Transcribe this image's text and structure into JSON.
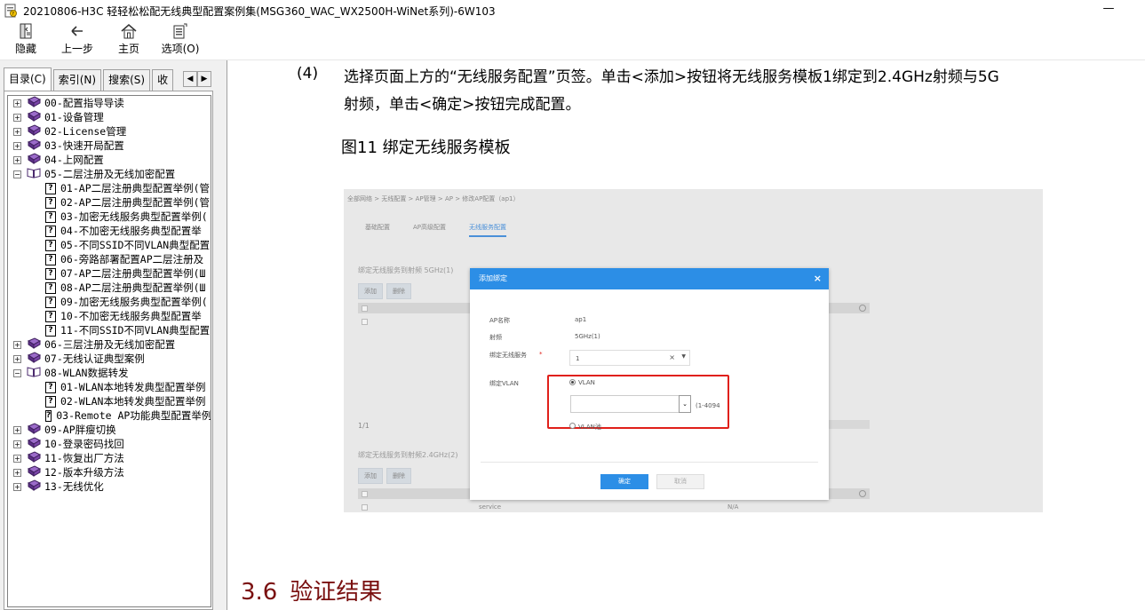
{
  "window": {
    "title": "20210806-H3C 轻轻松松配无线典型配置案例集(MSG360_WAC_WX2500H-WiNet系列)-6W103",
    "minimize_glyph": "—"
  },
  "toolbar": {
    "hide_label": "隐藏",
    "back_label": "上一步",
    "home_label": "主页",
    "options_label": "选项(O)"
  },
  "tabs": {
    "contents": "目录(C)",
    "index": "索引(N)",
    "search": "搜索(S)",
    "favorites": "收",
    "prev": "◀",
    "next": "▶"
  },
  "tree": {
    "items": [
      {
        "label": "00-配置指导导读",
        "exp": "+"
      },
      {
        "label": "01-设备管理",
        "exp": "+"
      },
      {
        "label": "02-License管理",
        "exp": "+"
      },
      {
        "label": "03-快速开局配置",
        "exp": "+"
      },
      {
        "label": "04-上网配置",
        "exp": "+"
      },
      {
        "label": "05-二层注册及无线加密配置",
        "exp": "−"
      }
    ],
    "children05": [
      "01-AP二层注册典型配置举例(管",
      "02-AP二层注册典型配置举例(管",
      "03-加密无线服务典型配置举例(",
      "04-不加密无线服务典型配置举",
      "05-不同SSID不同VLAN典型配置",
      "06-旁路部署配置AP二层注册及",
      "07-AP二层注册典型配置举例(Ш",
      "08-AP二层注册典型配置举例(Ш",
      "09-加密无线服务典型配置举例(",
      "10-不加密无线服务典型配置举",
      "11-不同SSID不同VLAN典型配置"
    ],
    "items2": [
      {
        "label": "06-三层注册及无线加密配置",
        "exp": "+"
      },
      {
        "label": "07-无线认证典型案例",
        "exp": "+"
      },
      {
        "label": "08-WLAN数据转发",
        "exp": "−"
      }
    ],
    "children08": [
      "01-WLAN本地转发典型配置举例",
      "02-WLAN本地转发典型配置举例",
      "03-Remote AP功能典型配置举例"
    ],
    "items3": [
      {
        "label": "09-AP胖瘦切换",
        "exp": "+"
      },
      {
        "label": "10-登录密码找回",
        "exp": "+"
      },
      {
        "label": "11-恢复出厂方法",
        "exp": "+"
      },
      {
        "label": "12-版本升级方法",
        "exp": "+"
      },
      {
        "label": "13-无线优化",
        "exp": "+"
      }
    ]
  },
  "doc": {
    "step_num": "(4)",
    "step_line1": "选择页面上方的“无线服务配置”页签。单击<添加>按钮将无线服务模板1绑定到2.4GHz射频与5G",
    "step_line2": "射频，单击<确定>按钮完成配置。",
    "figure_caption": "图11 绑定无线服务模板",
    "section_num": "3.6",
    "section_title": "验证结果"
  },
  "shot": {
    "breadcrumb": "全部网络 > 无线配置 > AP管理 > AP > 修改AP配置（ap1）",
    "tab1": "基础配置",
    "tab2": "AP高级配置",
    "tab3": "无线服务配置",
    "sec1": "绑定无线服务到射频 5GHz(1)",
    "add": "添加",
    "delete": "删除",
    "pager": "1/1",
    "sec2": "绑定无线服务到射频2.4GHz(2)",
    "row_service": "service",
    "row_na": "N/A",
    "dialog": {
      "title": "添加绑定",
      "close": "×",
      "ap_name_label": "AP名称",
      "ap_name_value": "ap1",
      "radio_label": "射频",
      "radio_value": "5GHz(1)",
      "bind_service_label": "绑定无线服务",
      "required": "*",
      "bind_service_value": "1",
      "bind_vlan_label": "绑定VLAN",
      "vlan_option": "VLAN",
      "vlan_range": "(1-4094",
      "vlan_pool_option": "VLAN池",
      "ok": "确定",
      "cancel": "取消"
    }
  }
}
